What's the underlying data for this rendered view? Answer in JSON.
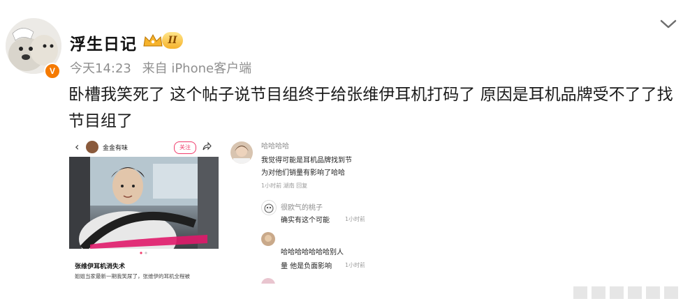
{
  "post": {
    "username": "浮生日记",
    "vip_level": "II",
    "verified_badge": "V",
    "time": "今天14:23",
    "source": "来自 iPhone客户端",
    "text": "卧槽我笑死了 这个帖子说节目组终于给张维伊耳机打码了 原因是耳机品牌受不了了找节目组了"
  },
  "image1": {
    "back_icon": "chevron-left-icon",
    "author_name": "金金有味",
    "follow_label": "关注",
    "caption_title": "张维伊耳机消失术",
    "caption_desc": "姐姐当家最新一期我笑尿了，张维伊的耳机全程被"
  },
  "image2": {
    "comment1": {
      "name": "哈哈哈哈",
      "line1": "我觉得可能是耳机品牌找到节",
      "line2": "为对他们销量有影响了哈哈",
      "meta": "1小时前  湖南  回复"
    },
    "reply1": {
      "name": "很欧气的桃子",
      "text": "确实有这个可能",
      "time": "1小时前"
    },
    "reply2": {
      "text_line1": "哈哈哈哈哈哈哈别人",
      "text_line2": "量 他是负面影响",
      "time": "1小时前"
    }
  },
  "colors": {
    "accent_orange": "#f57a00",
    "follow_pink": "#f03a6a",
    "meta_gray": "#8f8f8f"
  }
}
